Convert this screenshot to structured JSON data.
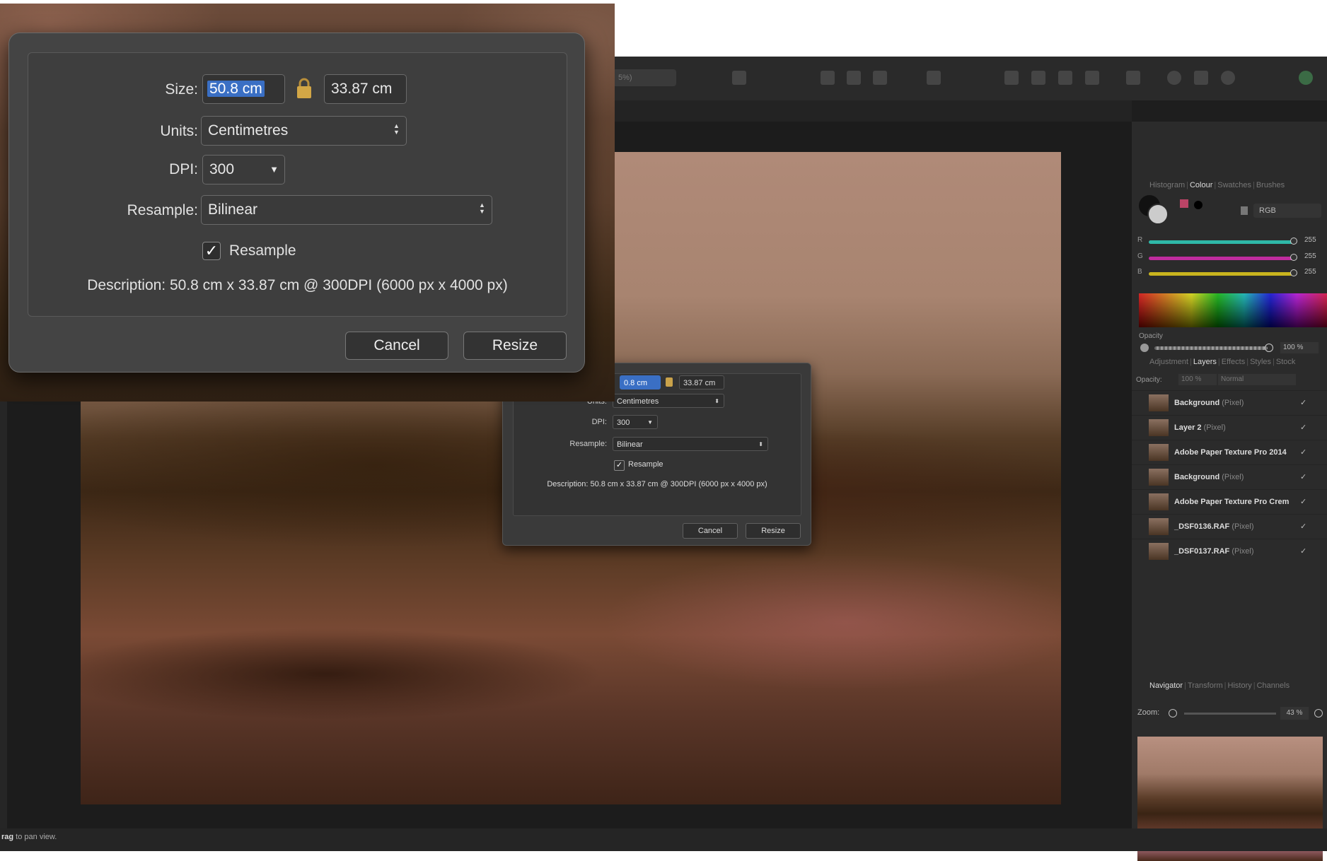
{
  "app": {
    "toolbar": {
      "zoom_field": "5%)"
    },
    "status_bar": {
      "drag_bold": "rag",
      "drag_hint": " to pan view."
    },
    "colour_panel": {
      "tabs": [
        "Histogram",
        "Colour",
        "Swatches",
        "Brushes"
      ],
      "active_tab": "Colour",
      "model": "RGB",
      "channels": [
        {
          "label": "R",
          "value": "255",
          "color": "#2fb8a8"
        },
        {
          "label": "G",
          "value": "255",
          "color": "#c02c9e"
        },
        {
          "label": "B",
          "value": "255",
          "color": "#c9b41e"
        }
      ],
      "opacity_label": "Opacity",
      "opacity_value": "100 %"
    },
    "layers_panel": {
      "tabs": [
        "Adjustment",
        "Layers",
        "Effects",
        "Styles",
        "Stock"
      ],
      "active_tab": "Layers",
      "opacity_label": "Opacity:",
      "opacity_value": "100 %",
      "blend_mode": "Normal",
      "layers": [
        {
          "name": "Background",
          "kind": "(Pixel)"
        },
        {
          "name": "Layer 2",
          "kind": "(Pixel)"
        },
        {
          "name": "Adobe Paper Texture Pro 2014",
          "kind": ""
        },
        {
          "name": "Background",
          "kind": "(Pixel)"
        },
        {
          "name": "Adobe Paper Texture Pro Crem",
          "kind": ""
        },
        {
          "name": "_DSF0136.RAF",
          "kind": "(Pixel)"
        },
        {
          "name": "_DSF0137.RAF",
          "kind": "(Pixel)"
        }
      ],
      "check": "✓"
    },
    "navigator_panel": {
      "tabs": [
        "Navigator",
        "Transform",
        "History",
        "Channels"
      ],
      "active_tab": "Navigator",
      "zoom_label": "Zoom:",
      "zoom_value": "43 %"
    }
  },
  "resize_dialog": {
    "size_label": "Size:",
    "width_value": "50.8 cm",
    "width_value_cropped": "0.8 cm",
    "height_value": "33.87 cm",
    "units_label": "Units:",
    "units_value": "Centimetres",
    "dpi_label": "DPI:",
    "dpi_value": "300",
    "resample_label": "Resample:",
    "resample_value": "Bilinear",
    "resample_checkbox_label": "Resample",
    "check": "✓",
    "description": "Description: 50.8 cm x 33.87 cm @ 300DPI (6000 px x 4000 px)",
    "cancel_label": "Cancel",
    "resize_label": "Resize"
  }
}
